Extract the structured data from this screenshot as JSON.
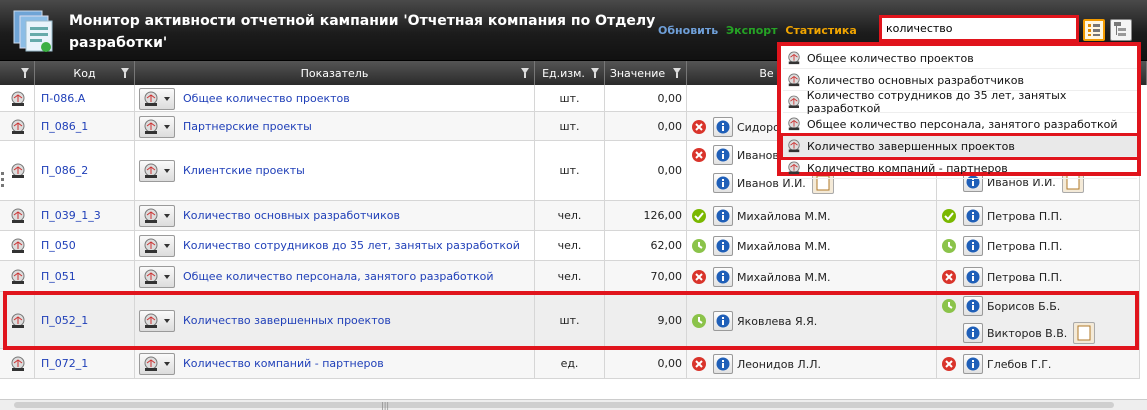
{
  "header": {
    "title": "Монитор активности отчетной кампании 'Отчетная компания по Отделу разработки'",
    "links": {
      "refresh": "Обновить",
      "export": "Экспорт",
      "stats": "Статистика"
    },
    "search": {
      "value": "количество"
    }
  },
  "columns": {
    "code": "Код",
    "indicator": "Показатель",
    "unit": "Ед.изм.",
    "value": "Значение",
    "responsible_partial": "Ве"
  },
  "rows": [
    {
      "code": "П-086.А",
      "name": "Общее количество проектов",
      "unit": "шт.",
      "value": "0,00",
      "a": [],
      "b": []
    },
    {
      "code": "П_086_1",
      "name": "Партнерские проекты",
      "unit": "шт.",
      "value": "0,00",
      "a": [
        "Сидоров"
      ],
      "b": []
    },
    {
      "code": "П_086_2",
      "name": "Клиентские проекты",
      "unit": "шт.",
      "value": "0,00",
      "a": [
        "Иванов",
        "Иванов И.И."
      ],
      "b": [
        "Иванов И.И."
      ]
    },
    {
      "code": "П_039_1_3",
      "name": "Количество основных разработчиков",
      "unit": "чел.",
      "value": "126,00",
      "a": [
        "Михайлова М.М."
      ],
      "b": [
        "Петрова П.П."
      ]
    },
    {
      "code": "П_050",
      "name": "Количество сотрудников до 35 лет, занятых разработкой",
      "unit": "чел.",
      "value": "62,00",
      "a": [
        "Михайлова М.М."
      ],
      "b": [
        "Петрова П.П."
      ]
    },
    {
      "code": "П_051",
      "name": "Общее количество персонала, занятого разработкой",
      "unit": "чел.",
      "value": "70,00",
      "a": [
        "Михайлова М.М."
      ],
      "b": [
        "Петрова П.П."
      ]
    },
    {
      "code": "П_052_1",
      "name": "Количество завершенных проектов",
      "unit": "шт.",
      "value": "9,00",
      "a": [
        "Яковлева Я.Я."
      ],
      "b": [
        "Борисов Б.Б.",
        "Викторов В.В."
      ]
    },
    {
      "code": "П_072_1",
      "name": "Количество компаний - партнеров",
      "unit": "ед.",
      "value": "0,00",
      "a": [
        "Леонидов Л.Л."
      ],
      "b": [
        "Глебов Г.Г."
      ]
    }
  ],
  "suggestions": [
    "Общее количество проектов",
    "Количество основных разработчиков",
    "Количество сотрудников до 35 лет, занятых разработкой",
    "Общее количество персонала, занятого разработкой",
    "Количество завершенных проектов",
    "Количество компаний - партнеров"
  ],
  "colors": {
    "accent": "#e0141c",
    "link": "#1f3fb8",
    "ok": "#7ab800",
    "err": "#d9342b",
    "info": "#1f5fb8"
  }
}
